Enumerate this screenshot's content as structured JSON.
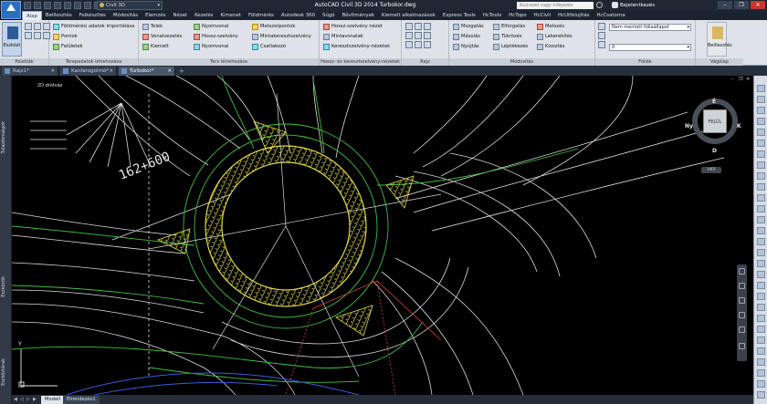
{
  "titlebar": {
    "workspace": "Civil 3D",
    "title": "AutoCAD Civil 3D 2014   Turbokor.dwg",
    "search_placeholder": "Kulcsszó vagy kifejezés",
    "signin": "Bejelentkezés"
  },
  "ribbon_tabs": [
    "Alap",
    "Beillesztés",
    "Felkészítés",
    "Módosítás",
    "Elemzés",
    "Nézet",
    "Kezelés",
    "Kimenet",
    "Földmérés",
    "Autodesk 360",
    "Súgó",
    "Bővítmények",
    "Kiemelt alkalmazások",
    "Express Tools",
    "HcTools",
    "HcTopo",
    "HcCivil",
    "HcUtfelujitás",
    "HcCsatorna"
  ],
  "panels": {
    "palettes": {
      "big": "Eszközt",
      "title": "Paletták"
    },
    "topo": {
      "items": [
        "Földmérési adatok importálása",
        "Pontok",
        "Felületek"
      ],
      "title": "Terepadatok létrehozása"
    },
    "design": {
      "items": [
        "Telek",
        "Vonalvezetés",
        "Kiemelt",
        "Nyomvonal",
        "Hossz-szelvény",
        "Nyomvonal",
        "Metszetpontok",
        "Mintakeresztszelvény",
        "Csatlakozó"
      ],
      "title": "Terv létrehozása"
    },
    "profile": {
      "items": [
        "Hossz-szelvény nézet",
        "Mintavonalak",
        "Keresztszelvény-nézetek"
      ],
      "title": "Hossz- és keresztszelvény-nézetek"
    },
    "draw": {
      "title": "Rajz"
    },
    "modify": {
      "items": [
        "Mozgatás",
        "Másolás",
        "Nyújtás",
        "Elforgatás",
        "Tükrözés",
        "Léptékezés",
        "Metszés",
        "Lekerekítés",
        "Kiosztás"
      ],
      "title": "Módosítás"
    },
    "layers": {
      "select": "Nem mentett fóliaállapot",
      "layer": "0",
      "title": "Fóliák"
    },
    "clipboard": {
      "big": "Beillesztés",
      "title": "Vágólap"
    }
  },
  "doc_tabs": [
    "Rajz1*",
    "Kanfarogolmó*",
    "Turbokor*"
  ],
  "viewport": {
    "label": "2D drótváz",
    "station_label": "162+600",
    "palette_labels": [
      "Tulajdonságok",
      "Eszközök",
      "Eszköztárak"
    ]
  },
  "viewcube": {
    "face": "FELÜL",
    "n": "É",
    "s": "D",
    "e": "K",
    "w": "Ny",
    "wcs": "VKR"
  },
  "layout_tabs": [
    "Modell",
    "Elrendezés1"
  ],
  "colors": {
    "ribbon": "#dfe3e9",
    "titlebar": "#1f2733",
    "hatch": "#e0d840",
    "cad_green": "#3fbf3f",
    "cad_blue": "#3c5bd8",
    "cad_red": "#d8403a"
  }
}
